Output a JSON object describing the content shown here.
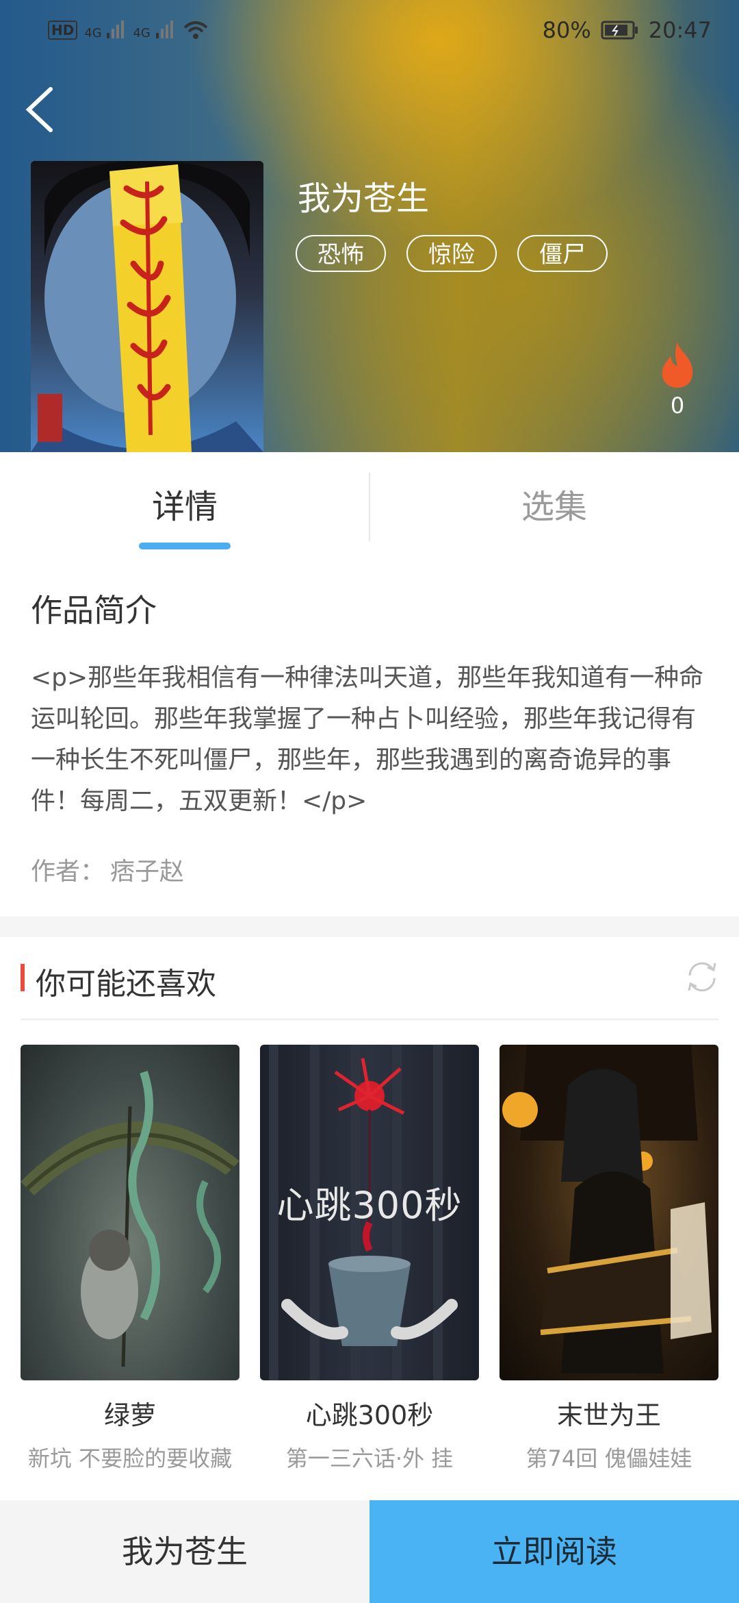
{
  "status_bar": {
    "network_left": "HD",
    "signal1": "4G",
    "signal2": "4G",
    "battery": "80%",
    "time": "20:47"
  },
  "comic": {
    "title": "我为苍生",
    "tags": [
      "恐怖",
      "惊险",
      "僵尸"
    ],
    "hot_count": "0"
  },
  "tabs": [
    {
      "label": "详情",
      "active": true
    },
    {
      "label": "选集",
      "active": false
    }
  ],
  "intro": {
    "heading": "作品简介",
    "text": "<p>那些年我相信有一种律法叫天道，那些年我知道有一种命运叫轮回。那些年我掌握了一种占卜叫经验，那些年我记得有一种长生不死叫僵尸，那些年，那些我遇到的离奇诡异的事件！每周二，五双更新！</p>",
    "author_label": "作者：",
    "author": "痞子赵"
  },
  "recommend": {
    "heading": "你可能还喜欢",
    "items": [
      {
        "title": "绿萝",
        "subtitle": "新坑 不要脸的要收藏"
      },
      {
        "title": "心跳300秒",
        "subtitle": "第一三六话·外 挂",
        "cover_text": "心跳300秒"
      },
      {
        "title": "末世为王",
        "subtitle": "第74回 傀儡娃娃"
      }
    ]
  },
  "bottom_bar": {
    "left_label": "我为苍生",
    "right_label": "立即阅读"
  },
  "colors": {
    "accent": "#4aaef0",
    "read_button": "#4ab3f4",
    "section_marker": "#e94b3c",
    "fire": "#f05a28"
  }
}
